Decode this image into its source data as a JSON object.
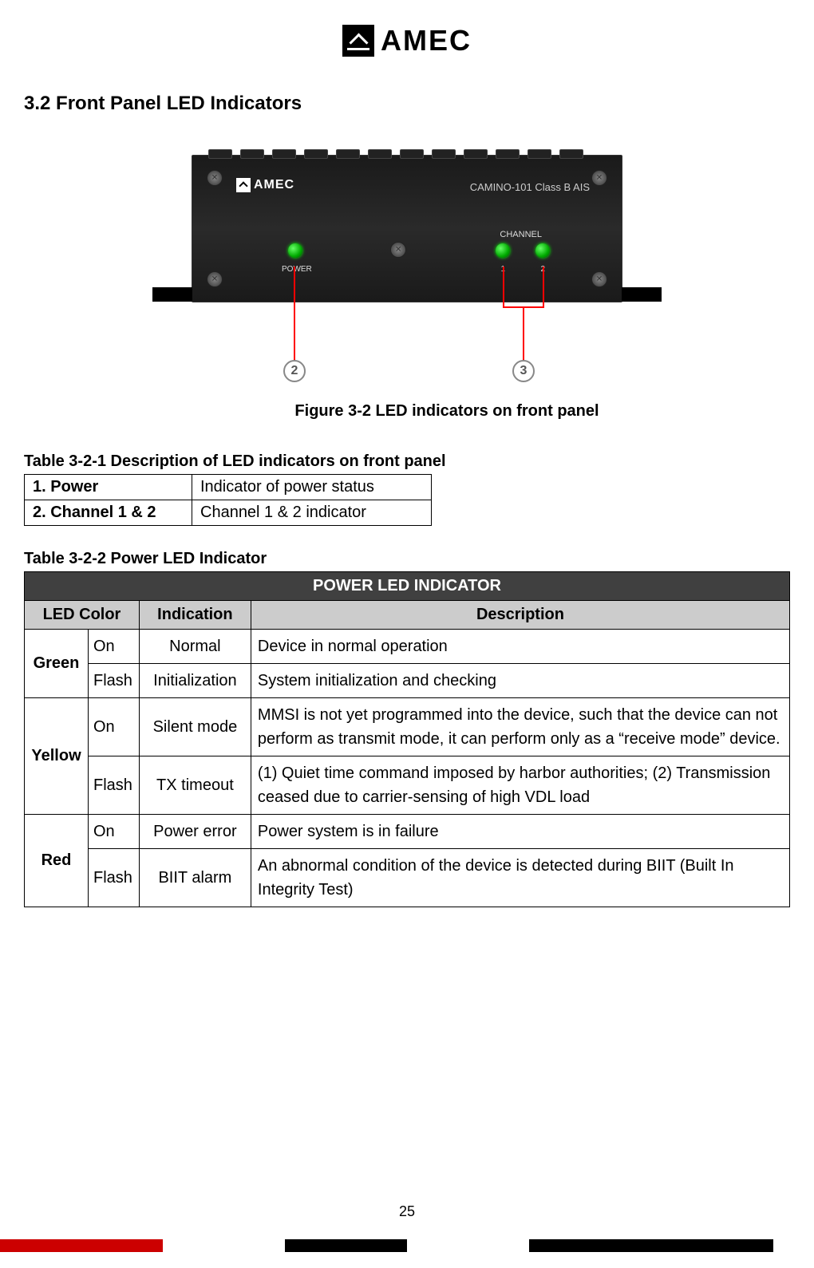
{
  "brand": "AMEC",
  "section_title": "3.2 Front Panel LED Indicators",
  "device": {
    "product_label": "CAMINO-101 Class B AIS",
    "power_label": "POWER",
    "channel_label": "CHANNEL",
    "ch1": "1",
    "ch2": "2"
  },
  "callouts": {
    "n2": "2",
    "n3": "3"
  },
  "figure_caption": "Figure 3-2 LED indicators on front panel",
  "table1": {
    "title": "Table 3-2-1 Description of LED indicators on front panel",
    "rows": [
      {
        "label": "1. Power",
        "desc": "Indicator of power status"
      },
      {
        "label": "2. Channel 1 & 2",
        "desc": "Channel 1 & 2 indicator"
      }
    ]
  },
  "table2": {
    "title": "Table 3-2-2 Power LED Indicator",
    "header_main": "POWER LED INDICATOR",
    "header_cols": {
      "c1": "LED Color",
      "c2": "Indication",
      "c3": "Description"
    },
    "groups": [
      {
        "color": "Green",
        "rows": [
          {
            "state": "On",
            "indication": "Normal",
            "desc": "Device in normal operation"
          },
          {
            "state": "Flash",
            "indication": "Initialization",
            "desc": "System initialization and checking"
          }
        ]
      },
      {
        "color": "Yellow",
        "rows": [
          {
            "state": "On",
            "indication": "Silent mode",
            "desc": "MMSI is not yet programmed into the device, such that the device can not perform as transmit mode, it can perform only as a “receive mode” device."
          },
          {
            "state": "Flash",
            "indication": "TX timeout",
            "desc": "(1) Quiet time command imposed by harbor authorities; (2) Transmission ceased due to carrier-sensing of high VDL load"
          }
        ]
      },
      {
        "color": "Red",
        "rows": [
          {
            "state": "On",
            "indication": "Power error",
            "desc": "Power system is in failure"
          },
          {
            "state": "Flash",
            "indication": "BIIT alarm",
            "desc": "An abnormal condition of the device is detected during BIIT (Built In Integrity Test)"
          }
        ]
      }
    ]
  },
  "page_number": "25"
}
